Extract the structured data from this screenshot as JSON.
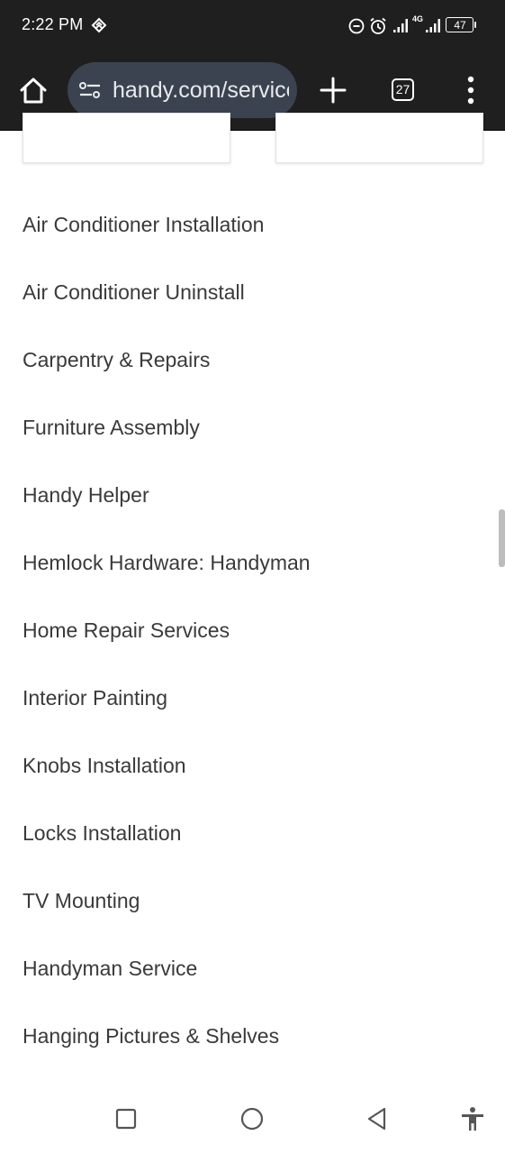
{
  "status_bar": {
    "time": "2:22 PM",
    "network_type": "4G",
    "battery_level": "47",
    "icons": [
      "sync-icon",
      "do-not-disturb-icon",
      "alarm-icon",
      "signal-icon",
      "signal-icon",
      "battery-icon"
    ]
  },
  "toolbar": {
    "url": "handy.com/services",
    "tab_count": "27",
    "icons": [
      "home-icon",
      "site-settings-icon",
      "plus-icon",
      "more-vert-icon"
    ]
  },
  "services": [
    "Air Conditioner Installation",
    "Air Conditioner Uninstall",
    "Carpentry & Repairs",
    "Furniture Assembly",
    "Handy Helper",
    "Hemlock Hardware: Handyman",
    "Home Repair Services",
    "Interior Painting",
    "Knobs Installation",
    "Locks Installation",
    "TV Mounting",
    "Handyman Service",
    "Hanging Pictures & Shelves"
  ],
  "nav_bar": {
    "icons": [
      "recents-square-icon",
      "home-circle-icon",
      "back-triangle-icon",
      "accessibility-icon"
    ]
  },
  "colors": {
    "toolbar_bg": "#1f1f1f",
    "omnibox_bg": "#3b4351",
    "text_dark": "#3a3a3a"
  }
}
